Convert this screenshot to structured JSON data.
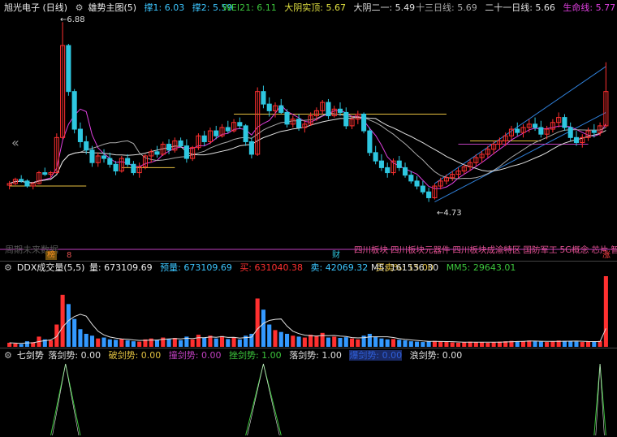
{
  "header": {
    "stock": "旭光电子 (日线)",
    "indicator": "雄势主图(5)",
    "support1": "撑1: 6.03",
    "support2": "撑2: 5.59",
    "wei21": "WEI21: 6.11",
    "dayang_shi": "大阴实顶: 5.67",
    "dayang_er": "大阴二一: 5.49",
    "ma13": "十三日线: 5.69",
    "ma21": "二十一日线: 5.66",
    "lifeline": "生命线: 5.77"
  },
  "main_labels": {
    "high": "6.88",
    "low": "4.73",
    "future": "周期未来数据",
    "concepts": [
      "四川板块",
      "四川板块",
      "元器件",
      "四川板块",
      "成渝特区",
      "国防军工",
      "5G概念",
      "芯片",
      "智能电网"
    ],
    "mark_left": "榜",
    "mark_left2": "8",
    "mark_mid": "财",
    "mark_right": "涨"
  },
  "volume_header": {
    "name": "DDX成交量(5,5)",
    "vol": "量: 673109.69",
    "predict": "预量: 673109.69",
    "buy": "买: 631040.38",
    "sell": "卖: 42069.32",
    "ratio": "买卖%: 15.00",
    "m5": "M5: 161536.30",
    "mm5": "MM5: 29643.01"
  },
  "sword_header": {
    "name": "七剑势",
    "s1": "落剑势: 0.00",
    "s2": "破剑势: 0.00",
    "s3": "撞剑势: 0.00",
    "s4": "挫剑势: 1.00",
    "s5": "落剑势: 1.00",
    "s6": "爆剑势: 0.00",
    "s7": "浪剑势: 0.00"
  },
  "colors": {
    "up": "#ff3030",
    "down": "#2ec7e0",
    "blue_vol": "#3399ff",
    "gold": "#e8c040",
    "purple": "#c040c0",
    "white": "#e0e0e0",
    "trend": "#2f7fd8",
    "green": "#3cc63c",
    "orange": "#f08c20",
    "magenta": "#e040e0",
    "yellow": "#e0e040"
  },
  "chart_data": {
    "type": "candlestick",
    "ylim": [
      4.6,
      6.95
    ],
    "candles": [
      [
        4.93,
        4.98,
        4.88,
        4.95
      ],
      [
        4.95,
        5.02,
        4.93,
        5.0
      ],
      [
        5.0,
        5.05,
        4.96,
        4.98
      ],
      [
        4.98,
        5.0,
        4.9,
        4.92
      ],
      [
        4.92,
        4.97,
        4.88,
        4.95
      ],
      [
        4.95,
        5.1,
        4.94,
        5.08
      ],
      [
        5.08,
        5.14,
        5.04,
        5.06
      ],
      [
        5.06,
        5.1,
        5.02,
        5.08
      ],
      [
        5.08,
        5.55,
        5.07,
        5.5
      ],
      [
        5.5,
        6.88,
        5.48,
        6.6
      ],
      [
        6.6,
        6.62,
        6.0,
        6.05
      ],
      [
        6.05,
        6.08,
        5.55,
        5.6
      ],
      [
        5.6,
        5.68,
        5.38,
        5.45
      ],
      [
        5.45,
        5.52,
        5.3,
        5.35
      ],
      [
        5.35,
        5.4,
        5.15,
        5.2
      ],
      [
        5.2,
        5.32,
        5.15,
        5.28
      ],
      [
        5.28,
        5.36,
        5.2,
        5.25
      ],
      [
        5.25,
        5.32,
        5.14,
        5.18
      ],
      [
        5.18,
        5.22,
        5.05,
        5.1
      ],
      [
        5.1,
        5.28,
        5.08,
        5.25
      ],
      [
        5.25,
        5.3,
        5.15,
        5.18
      ],
      [
        5.18,
        5.22,
        5.05,
        5.08
      ],
      [
        5.08,
        5.2,
        5.02,
        5.15
      ],
      [
        5.15,
        5.3,
        5.12,
        5.28
      ],
      [
        5.28,
        5.36,
        5.2,
        5.33
      ],
      [
        5.33,
        5.4,
        5.26,
        5.3
      ],
      [
        5.3,
        5.45,
        5.28,
        5.42
      ],
      [
        5.42,
        5.48,
        5.3,
        5.35
      ],
      [
        5.35,
        5.5,
        5.32,
        5.46
      ],
      [
        5.46,
        5.5,
        5.38,
        5.4
      ],
      [
        5.4,
        5.48,
        5.2,
        5.25
      ],
      [
        5.25,
        5.4,
        5.22,
        5.38
      ],
      [
        5.38,
        5.55,
        5.35,
        5.52
      ],
      [
        5.52,
        5.58,
        5.4,
        5.45
      ],
      [
        5.45,
        5.62,
        5.42,
        5.58
      ],
      [
        5.58,
        5.64,
        5.48,
        5.52
      ],
      [
        5.52,
        5.66,
        5.5,
        5.62
      ],
      [
        5.62,
        5.7,
        5.55,
        5.58
      ],
      [
        5.58,
        5.72,
        5.56,
        5.68
      ],
      [
        5.68,
        5.74,
        5.6,
        5.64
      ],
      [
        5.64,
        5.66,
        5.4,
        5.45
      ],
      [
        5.45,
        5.5,
        5.25,
        5.3
      ],
      [
        5.3,
        6.1,
        5.28,
        6.05
      ],
      [
        6.05,
        6.12,
        5.85,
        5.9
      ],
      [
        5.9,
        5.98,
        5.75,
        5.82
      ],
      [
        5.82,
        5.92,
        5.74,
        5.88
      ],
      [
        5.88,
        5.96,
        5.78,
        5.8
      ],
      [
        5.8,
        5.84,
        5.62,
        5.66
      ],
      [
        5.66,
        5.76,
        5.62,
        5.72
      ],
      [
        5.72,
        5.78,
        5.58,
        5.62
      ],
      [
        5.62,
        5.7,
        5.56,
        5.66
      ],
      [
        5.66,
        5.8,
        5.64,
        5.76
      ],
      [
        5.76,
        5.86,
        5.7,
        5.82
      ],
      [
        5.82,
        5.95,
        5.78,
        5.92
      ],
      [
        5.92,
        5.96,
        5.72,
        5.76
      ],
      [
        5.76,
        5.88,
        5.74,
        5.84
      ],
      [
        5.84,
        5.92,
        5.76,
        5.8
      ],
      [
        5.8,
        5.86,
        5.6,
        5.64
      ],
      [
        5.64,
        5.76,
        5.6,
        5.72
      ],
      [
        5.72,
        5.82,
        5.66,
        5.78
      ],
      [
        5.78,
        5.8,
        5.55,
        5.58
      ],
      [
        5.58,
        5.62,
        5.28,
        5.32
      ],
      [
        5.32,
        5.4,
        5.18,
        5.22
      ],
      [
        5.22,
        5.3,
        5.1,
        5.14
      ],
      [
        5.14,
        5.2,
        5.02,
        5.08
      ],
      [
        5.08,
        5.25,
        5.05,
        5.22
      ],
      [
        5.22,
        5.28,
        5.1,
        5.14
      ],
      [
        5.14,
        5.2,
        5.02,
        5.05
      ],
      [
        5.05,
        5.1,
        4.95,
        4.98
      ],
      [
        4.98,
        5.04,
        4.88,
        4.92
      ],
      [
        4.92,
        4.98,
        4.82,
        4.85
      ],
      [
        4.85,
        4.9,
        4.73,
        4.78
      ],
      [
        4.78,
        4.95,
        4.76,
        4.92
      ],
      [
        4.92,
        5.02,
        4.88,
        4.98
      ],
      [
        4.98,
        5.06,
        4.94,
        5.02
      ],
      [
        5.02,
        5.1,
        4.98,
        5.06
      ],
      [
        5.06,
        5.14,
        5.02,
        5.1
      ],
      [
        5.1,
        5.18,
        5.06,
        5.15
      ],
      [
        5.15,
        5.24,
        5.1,
        5.2
      ],
      [
        5.2,
        5.3,
        5.16,
        5.26
      ],
      [
        5.26,
        5.34,
        5.2,
        5.3
      ],
      [
        5.3,
        5.4,
        5.26,
        5.36
      ],
      [
        5.36,
        5.46,
        5.3,
        5.42
      ],
      [
        5.42,
        5.5,
        5.36,
        5.46
      ],
      [
        5.46,
        5.56,
        5.4,
        5.52
      ],
      [
        5.52,
        5.64,
        5.48,
        5.6
      ],
      [
        5.6,
        5.68,
        5.52,
        5.56
      ],
      [
        5.56,
        5.66,
        5.5,
        5.62
      ],
      [
        5.62,
        5.72,
        5.56,
        5.66
      ],
      [
        5.66,
        5.74,
        5.58,
        5.62
      ],
      [
        5.62,
        5.7,
        5.5,
        5.54
      ],
      [
        5.54,
        5.64,
        5.48,
        5.6
      ],
      [
        5.6,
        5.72,
        5.56,
        5.68
      ],
      [
        5.68,
        5.8,
        5.62,
        5.74
      ],
      [
        5.74,
        5.78,
        5.58,
        5.62
      ],
      [
        5.62,
        5.68,
        5.46,
        5.5
      ],
      [
        5.5,
        5.58,
        5.4,
        5.44
      ],
      [
        5.44,
        5.54,
        5.38,
        5.5
      ],
      [
        5.5,
        5.62,
        5.46,
        5.58
      ],
      [
        5.58,
        5.66,
        5.5,
        5.56
      ],
      [
        5.56,
        5.68,
        5.52,
        5.64
      ],
      [
        5.64,
        6.4,
        5.62,
        6.05
      ]
    ],
    "volume": [
      22,
      18,
      15,
      30,
      25,
      55,
      40,
      35,
      120,
      280,
      230,
      150,
      95,
      70,
      60,
      45,
      50,
      40,
      38,
      42,
      35,
      30,
      28,
      40,
      45,
      38,
      50,
      42,
      48,
      36,
      55,
      40,
      65,
      48,
      60,
      45,
      58,
      42,
      50,
      40,
      60,
      70,
      260,
      200,
      120,
      90,
      80,
      70,
      60,
      55,
      50,
      65,
      60,
      75,
      50,
      55,
      48,
      52,
      45,
      40,
      60,
      70,
      55,
      45,
      40,
      42,
      38,
      35,
      30,
      28,
      26,
      30,
      32,
      28,
      26,
      24,
      22,
      25,
      28,
      26,
      24,
      22,
      26,
      28,
      30,
      32,
      28,
      30,
      34,
      30,
      28,
      26,
      30,
      34,
      32,
      30,
      28,
      26,
      28,
      30,
      32,
      380
    ],
    "signals": [
      {
        "start": 7,
        "end": 12,
        "peak": 1.0
      },
      {
        "start": 40,
        "end": 46,
        "peak": 1.0
      },
      {
        "start": 99,
        "end": 101,
        "peak": 1.0
      }
    ]
  }
}
